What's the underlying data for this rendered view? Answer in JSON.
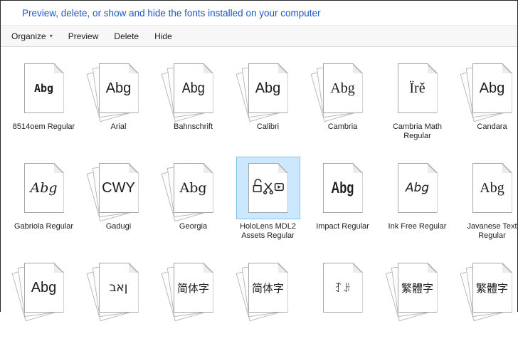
{
  "header": {
    "title": "Preview, delete, or show and hide the fonts installed on your computer"
  },
  "toolbar": {
    "items": [
      {
        "label": "Organize",
        "caret": "▾",
        "has_dropdown": true
      },
      {
        "label": "Preview"
      },
      {
        "label": "Delete"
      },
      {
        "label": "Hide"
      }
    ]
  },
  "colors": {
    "header_text": "#2057c0",
    "toolbar_bg": "#f7f7f7",
    "selection_fill": "#cce8ff",
    "selection_border": "#84c3ee"
  },
  "grid": {
    "items": [
      {
        "label": "8514oem Regular",
        "preview": "Abg",
        "style": "pixel",
        "stacked": false
      },
      {
        "label": "Arial",
        "preview": "Abg",
        "style": "sans",
        "stacked": true
      },
      {
        "label": "Bahnschrift",
        "preview": "Abg",
        "style": "sans-cond",
        "stacked": true
      },
      {
        "label": "Calibri",
        "preview": "Abg",
        "style": "sans",
        "stacked": true
      },
      {
        "label": "Cambria",
        "preview": "Abg",
        "style": "serif",
        "stacked": true
      },
      {
        "label": "Cambria Math Regular",
        "preview": "Ïrě",
        "style": "serif",
        "stacked": false
      },
      {
        "label": "Candara",
        "preview": "Abg",
        "style": "sans",
        "stacked": true
      },
      {
        "label": "Gabriola Regular",
        "preview": "Abg",
        "style": "script",
        "stacked": false
      },
      {
        "label": "Gadugi",
        "preview": "CWY",
        "style": "sans",
        "stacked": true
      },
      {
        "label": "Georgia",
        "preview": "Abg",
        "style": "georgia",
        "stacked": true
      },
      {
        "label": "HoloLens MDL2 Assets Regular",
        "style": "icons",
        "stacked": false,
        "selected": true,
        "preview_icons": [
          "unlocked-padlock",
          "scissors",
          "video-play"
        ]
      },
      {
        "label": "Impact Regular",
        "preview": "Abg",
        "style": "impact",
        "stacked": false
      },
      {
        "label": "Ink Free Regular",
        "preview": "Abg",
        "style": "ink",
        "stacked": false
      },
      {
        "label": "Javanese Text Regular",
        "preview": "Abg",
        "style": "serif",
        "stacked": false
      },
      {
        "label": "",
        "preview": "Abg",
        "style": "sans",
        "stacked": true
      },
      {
        "label": "",
        "preview": "ןאב",
        "style": "hebrew",
        "stacked": true
      },
      {
        "label": "",
        "preview": "简体字",
        "style": "cjk",
        "stacked": true
      },
      {
        "label": "",
        "preview": "简体字",
        "style": "cjk",
        "stacked": true
      },
      {
        "label": "",
        "preview": "ꆈꌠ",
        "style": "cjk",
        "stacked": false
      },
      {
        "label": "",
        "preview": "繁體字",
        "style": "cjk",
        "stacked": true
      },
      {
        "label": "",
        "preview": "繁體字",
        "style": "cjk",
        "stacked": true
      }
    ]
  }
}
